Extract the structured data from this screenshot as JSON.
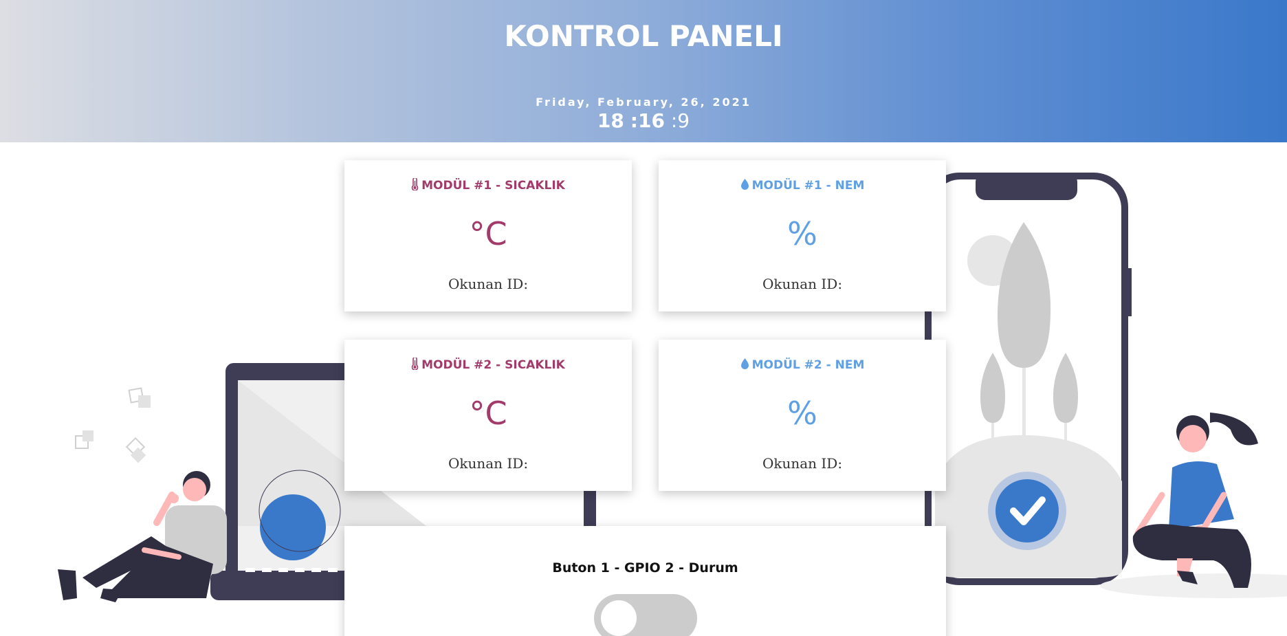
{
  "header": {
    "title": "KONTROL PANELI",
    "date": "Friday, February, 26, 2021",
    "clock": {
      "hours": "18",
      "minutes": "16",
      "seconds": "9",
      "sep": ":"
    }
  },
  "cards": [
    {
      "title": "MODÜL #1 - SICAKLIK",
      "unit": "°C",
      "read_label": "Okunan ID:",
      "icon": "thermometer-icon"
    },
    {
      "title": "MODÜL #1 - NEM",
      "unit": "%",
      "read_label": "Okunan ID:",
      "icon": "water-drop-icon"
    },
    {
      "title": "MODÜL #2 - SICAKLIK",
      "unit": "°C",
      "read_label": "Okunan ID:",
      "icon": "thermometer-icon"
    },
    {
      "title": "MODÜL #2 - NEM",
      "unit": "%",
      "read_label": "Okunan ID:",
      "icon": "water-drop-icon"
    }
  ],
  "button_card": {
    "label": "Buton 1 - GPIO 2 - Durum",
    "toggle_state": "off"
  },
  "colors": {
    "temperature": "#a23b6a",
    "humidity": "#5fa0e4",
    "accent": "#3a78ca",
    "toggle_off": "#cccccc"
  }
}
